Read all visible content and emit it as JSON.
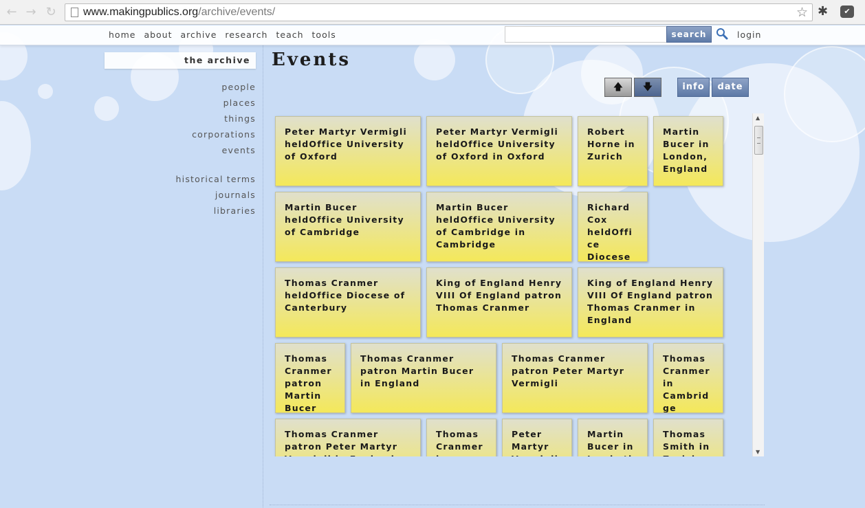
{
  "browser": {
    "url_domain": "www.makingpublics.org",
    "url_path": "/archive/events/",
    "back_icon": "←",
    "forward_icon": "→",
    "reload_icon": "↻",
    "star_icon": "☆",
    "ext_icon": "✱",
    "pocket_icon": "✔"
  },
  "topnav": {
    "items": [
      "home",
      "about",
      "archive",
      "research",
      "teach",
      "tools"
    ],
    "search_label": "search",
    "search_value": "",
    "login_label": "login"
  },
  "sidebar": {
    "title": "the archive",
    "group1": [
      "people",
      "places",
      "things",
      "corporations",
      "events"
    ],
    "group2": [
      "historical terms",
      "journals",
      "libraries"
    ]
  },
  "main": {
    "title": "Events",
    "sort_up_icon": "🡅",
    "sort_down_icon": "🡇",
    "view_info_label": "info",
    "view_date_label": "date",
    "events": [
      "Peter Martyr Vermigli heldOffice University of Oxford",
      "Peter Martyr Vermigli heldOffice University of Oxford in Oxford",
      "Robert Horne in Zurich",
      "Martin Bucer in London, England",
      "Martin Bucer heldOffice University of Cambridge",
      "Martin Bucer heldOffice University of Cambridge in Cambridge",
      "Richard Cox heldOffice Diocese of Ely",
      "Thomas Cranmer heldOffice Diocese of Canterbury",
      "King of England Henry VIII Of England patron Thomas Cranmer",
      "King of England Henry VIII Of England patron Thomas Cranmer in England",
      "Thomas Cranmer patron Martin Bucer",
      "Thomas Cranmer patron Martin Bucer in England",
      "Thomas Cranmer patron Peter Martyr Vermigli",
      "Thomas Cranmer in Cambridge",
      "Thomas Cranmer patron Peter Martyr Vermigli in England",
      "Thomas Cranmer in Oxford",
      "Peter Martyr Vermigli in ...",
      "Martin Bucer in Lambeth",
      "Thomas Smith in Zurich"
    ]
  }
}
